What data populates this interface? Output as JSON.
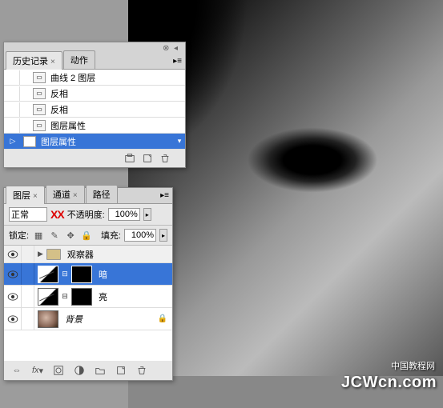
{
  "history_panel": {
    "tabs": [
      {
        "label": "历史记录",
        "active": true,
        "closeable": true
      },
      {
        "label": "动作",
        "active": false,
        "closeable": false
      }
    ],
    "items": [
      {
        "label": "曲线 2 图层",
        "selected": false,
        "marker": false
      },
      {
        "label": "反相",
        "selected": false,
        "marker": false
      },
      {
        "label": "反相",
        "selected": false,
        "marker": false
      },
      {
        "label": "图层属性",
        "selected": false,
        "marker": false
      },
      {
        "label": "图层属性",
        "selected": true,
        "marker": true
      }
    ]
  },
  "layers_panel": {
    "tabs": [
      {
        "label": "图层",
        "active": true,
        "closeable": true
      },
      {
        "label": "通道",
        "active": false,
        "closeable": true
      },
      {
        "label": "路径",
        "active": false,
        "closeable": false
      }
    ],
    "blend_mode": "正常",
    "xx_mark": "XX",
    "opacity_label": "不透明度:",
    "opacity_value": "100%",
    "lock_label": "锁定:",
    "fill_label": "填充:",
    "fill_value": "100%",
    "layers": [
      {
        "type": "group",
        "name": "观察器",
        "visible": true
      },
      {
        "type": "adjustment",
        "name": "暗",
        "visible": true,
        "selected": true,
        "mask": true
      },
      {
        "type": "adjustment",
        "name": "亮",
        "visible": true,
        "selected": false,
        "mask": true
      },
      {
        "type": "background",
        "name": "背景",
        "visible": true,
        "italic": true
      }
    ]
  },
  "watermark": {
    "text": "中国教程网",
    "url": "JCWcn.com"
  }
}
